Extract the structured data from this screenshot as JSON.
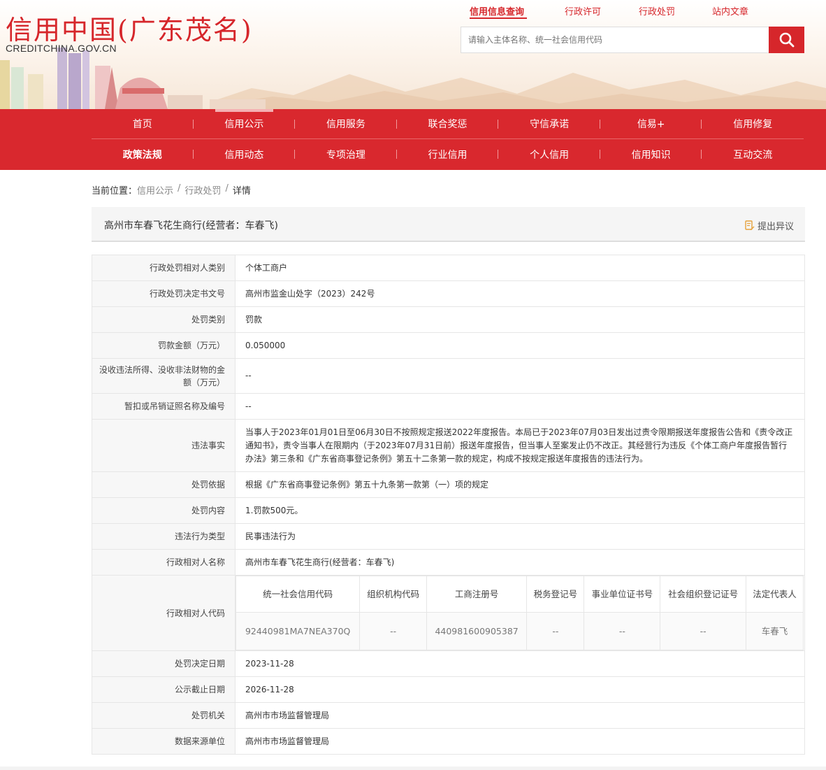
{
  "site": {
    "title": "信用中国(广东茂名)",
    "subtitle": "CREDITCHINA.GOV.CN"
  },
  "topnav": {
    "items": [
      "信用信息查询",
      "行政许可",
      "行政处罚",
      "站内文章"
    ]
  },
  "search": {
    "placeholder": "请输入主体名称、统一社会信用代码"
  },
  "mainnav": {
    "row1": [
      "首页",
      "信用公示",
      "信用服务",
      "联合奖惩",
      "守信承诺",
      "信易+",
      "信用修复"
    ],
    "row2": [
      "政策法规",
      "信用动态",
      "专项治理",
      "行业信用",
      "个人信用",
      "信用知识",
      "互动交流"
    ]
  },
  "breadcrumb": {
    "label": "当前位置：",
    "items": [
      "信用公示",
      "行政处罚",
      "详情"
    ]
  },
  "record": {
    "title": "高州市车春飞花生商行(经营者：车春飞)",
    "objection": "提出异议"
  },
  "details": [
    {
      "label": "行政处罚相对人类别",
      "value": "个体工商户"
    },
    {
      "label": "行政处罚决定书文号",
      "value": "高州市监金山处字（2023）242号"
    },
    {
      "label": "处罚类别",
      "value": "罚款"
    },
    {
      "label": "罚款金额（万元）",
      "value": "0.050000"
    },
    {
      "label": "没收违法所得、没收非法财物的金额（万元）",
      "value": "--"
    },
    {
      "label": "暂扣或吊销证照名称及编号",
      "value": "--"
    },
    {
      "label": "违法事实",
      "value": "当事人于2023年01月01日至06月30日不按照规定报送2022年度报告。本局已于2023年07月03日发出过责令限期报送年度报告公告和《责令改正通知书》，责令当事人在限期内（于2023年07月31日前）报送年度报告，但当事人至案发止仍不改正。其经营行为违反《个体工商户年度报告暂行办法》第三条和《广东省商事登记条例》第五十二条第一款的规定，构成不按规定报送年度报告的违法行为。"
    },
    {
      "label": "处罚依据",
      "value": "根据《广东省商事登记条例》第五十九条第一款第（一）项的规定"
    },
    {
      "label": "处罚内容",
      "value": "1.罚款500元。"
    },
    {
      "label": "违法行为类型",
      "value": "民事违法行为"
    },
    {
      "label": "行政相对人名称",
      "value": "高州市车春飞花生商行(经营者：车春飞)"
    }
  ],
  "codes": {
    "label": "行政相对人代码",
    "headers": [
      "统一社会信用代码",
      "组织机构代码",
      "工商注册号",
      "税务登记号",
      "事业单位证书号",
      "社会组织登记证号",
      "法定代表人"
    ],
    "values": [
      "92440981MA7NEA370Q",
      "--",
      "440981600905387",
      "--",
      "--",
      "--",
      "车春飞"
    ]
  },
  "details2": [
    {
      "label": "处罚决定日期",
      "value": "2023-11-28"
    },
    {
      "label": "公示截止日期",
      "value": "2026-11-28"
    },
    {
      "label": "处罚机关",
      "value": "高州市市场监督管理局"
    },
    {
      "label": "数据来源单位",
      "value": "高州市市场监督管理局"
    }
  ],
  "colors": {
    "brand_red": "#d6262b",
    "nav_red": "#d9282e"
  }
}
